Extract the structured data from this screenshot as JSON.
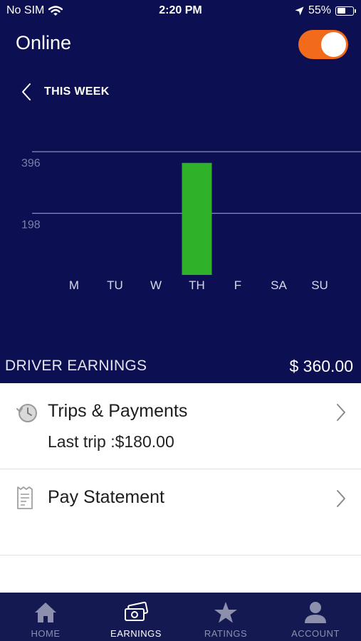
{
  "status_bar": {
    "carrier": "No SIM",
    "time": "2:20 PM",
    "battery": "55%",
    "battery_level": 0.55
  },
  "header": {
    "online_label": "Online",
    "online_toggle_on": true,
    "toggle_color": "#f26a1b"
  },
  "week_nav": {
    "label": "THIS WEEK"
  },
  "chart_data": {
    "type": "bar",
    "categories": [
      "M",
      "TU",
      "W",
      "TH",
      "F",
      "SA",
      "SU"
    ],
    "values": [
      0,
      0,
      0,
      360,
      0,
      0,
      0
    ],
    "gridlines": [
      396,
      198
    ],
    "ylim": [
      0,
      396
    ],
    "grid": true,
    "bar_color": "#2fb12a"
  },
  "earnings": {
    "label": "DRIVER EARNINGS",
    "amount": "$ 360.00"
  },
  "rows": [
    {
      "title": "Trips & Payments",
      "subtitle": "Last trip :$180.00",
      "icon": "history-clock-icon"
    },
    {
      "title": "Pay Statement",
      "icon": "receipt-icon"
    }
  ],
  "tabs": [
    {
      "label": "HOME",
      "icon": "home-icon",
      "active": false
    },
    {
      "label": "EARNINGS",
      "icon": "earnings-icon",
      "active": true
    },
    {
      "label": "RATINGS",
      "icon": "star-icon",
      "active": false
    },
    {
      "label": "ACCOUNT",
      "icon": "account-icon",
      "active": false
    }
  ]
}
